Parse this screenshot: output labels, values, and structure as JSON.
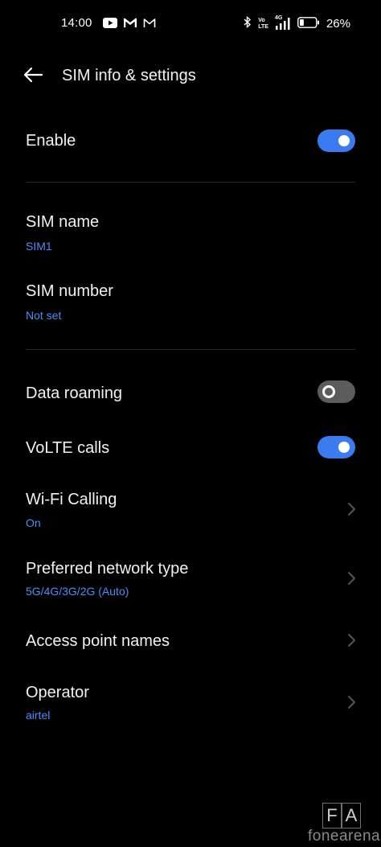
{
  "status_bar": {
    "time": "14:00",
    "battery_percent": "26%",
    "battery_level": 0.26,
    "left_icons": [
      "youtube-icon",
      "gmail-icon",
      "gmail-icon"
    ],
    "right_icons": [
      "bluetooth-icon",
      "volte-icon",
      "signal-4g-icon",
      "battery-icon"
    ],
    "volte_label_top": "Vo",
    "volte_label_bottom": "LTE",
    "network_label": "4G"
  },
  "header": {
    "back_icon": "arrow-left-icon",
    "title": "SIM info & settings"
  },
  "settings": {
    "enable": {
      "title": "Enable",
      "toggle": true
    },
    "sim_name": {
      "title": "SIM name",
      "value": "SIM1"
    },
    "sim_number": {
      "title": "SIM number",
      "value": "Not set"
    },
    "data_roaming": {
      "title": "Data roaming",
      "toggle": false
    },
    "volte_calls": {
      "title": "VoLTE calls",
      "toggle": true
    },
    "wifi_calling": {
      "title": "Wi-Fi Calling",
      "value": "On"
    },
    "preferred_network": {
      "title": "Preferred network type",
      "value": "5G/4G/3G/2G (Auto)"
    },
    "apn": {
      "title": "Access point names"
    },
    "operator": {
      "title": "Operator",
      "value": "airtel"
    }
  },
  "colors": {
    "background": "#000000",
    "accent": "#3a7cf0",
    "subtitle": "#4c8df6",
    "toggle_off": "#5c5c5c"
  },
  "watermark": {
    "letter_1": "F",
    "letter_2": "A",
    "text": "fonearena"
  }
}
